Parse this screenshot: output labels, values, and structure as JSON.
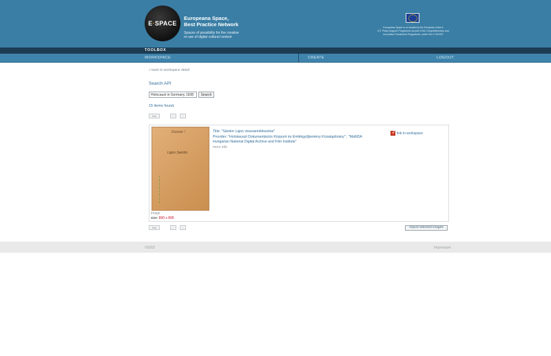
{
  "header": {
    "logo_text_left": "E",
    "logo_text_right": "SPACE",
    "brand_title_line1": "Europeana Space,",
    "brand_title_line2": "Best Practice Network",
    "brand_sub_line1": "Spaces of possibility for the creative",
    "brand_sub_line2": "re-use of digital cultural content",
    "eu_text_line1": "Europeana Space is co-funded by the European Union's",
    "eu_text_line2": "ICT Policy Support Programme as part of the Competitiveness and",
    "eu_text_line3": "Innovation Framework Programme, under GA n° 621037",
    "toolbox_label": "TOOLBOX"
  },
  "nav": {
    "workspace": "WORKSPACE",
    "create": "CREATE",
    "logout": "LOGOUT"
  },
  "page": {
    "back_link": "« back to workspace detail",
    "title": "Search API",
    "search_value": "Holocaust in Germany 1938",
    "search_button": "Search",
    "items_found": "15 items found."
  },
  "pager": {
    "first": "first",
    "prev": "‹",
    "next": "›"
  },
  "result": {
    "thumb_hand_1": "Dossier /",
    "thumb_hand_2": "Lajos Sandor",
    "title": "Title: \"Sándor Lajos visszaemlékezése\"",
    "provider": "Provider: \"Holokauszt Dokumentációs Központ és Emlékgyűjtemény Közalapítvány\" ; \"MaNDA Hungarian National Digital Archive and Film Institute\"",
    "more_info": "more info",
    "type": "image",
    "size_label": "size:",
    "size_value": "800 x 895",
    "workspace_label": "link in workspace"
  },
  "import_button": "import selected images",
  "footer": {
    "copyright": "©2015",
    "imprint": "Impressum"
  },
  "colors": {
    "header_bg": "#3a7ea5",
    "nav_bg": "#3f84ac",
    "dark_strip": "#1c3c52",
    "link_blue": "#2f6c9a",
    "accent_red": "#c8102e"
  }
}
